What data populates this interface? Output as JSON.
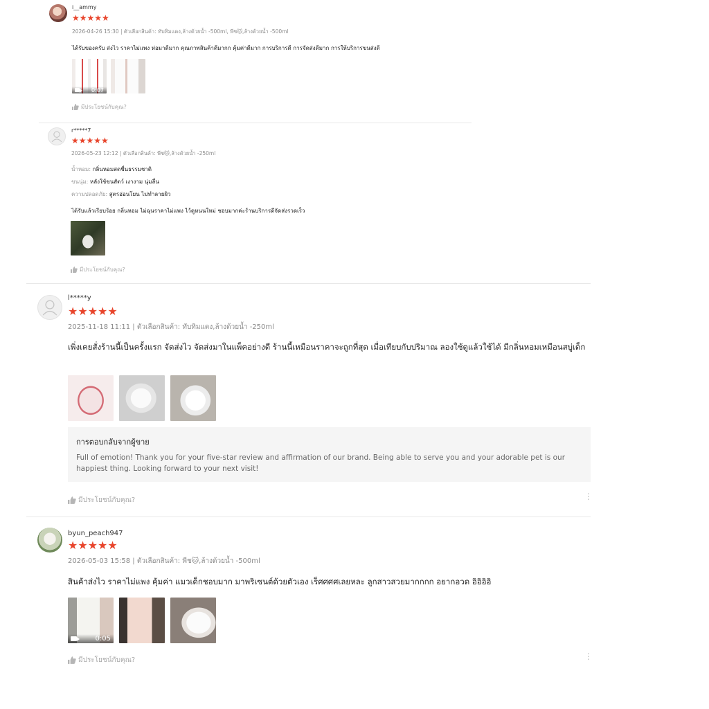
{
  "reviews": [
    {
      "username": "i__ammy",
      "stars": "★★★★★",
      "meta": "2026-04-26 15:30 | ตัวเลือกสินค้า: ทับทิมแดง,ล้างด้วยน้ำ -500ml, พีช🐱,ล้างด้วยน้ำ -500ml",
      "text": "ได้รับของครับ ส่งไว ราคาไม่แพง ห่อมาดีมาก คุณภาพสินค้าดีมากก คุ้มค่าดีมาก การบริการดี การจัดส่งดีมาก การให้บริการขนส่งดี",
      "video_duration": "0:07",
      "helpful": "มีประโยชน์กับคุณ?"
    },
    {
      "username": "r*****7",
      "stars": "★★★★★",
      "meta": "2026-05-23 12:12 | ตัวเลือกสินค้า: พีช🐱,ล้างด้วยน้ำ -250ml",
      "attributes": [
        {
          "key": "น้ำหอม:",
          "value": "กลิ่นหอมสดชื่นธรรมชาติ"
        },
        {
          "key": "ขนนุ่ม:",
          "value": "หลังใช้ขนสัตว์ เงางาม นุ่มลื่น"
        },
        {
          "key": "ความปลอดภัย:",
          "value": "สูตรอ่อนโยน ไม่ทำลายผิว"
        }
      ],
      "text": "ได้รับแล้วเรียบร้อย กลิ่นหอม ไม่ฉุนราคาไม่แพง ไว้ดูหนนใหม่ ชอบมากค่ะร้านบริการดีจัดส่งรวดเร็ว",
      "helpful": "มีประโยชน์กับคุณ?"
    },
    {
      "username": "l*****y",
      "stars": "★★★★★",
      "meta": "2025-11-18 11:11 | ตัวเลือกสินค้า: ทับทิมแดง,ล้างด้วยน้ำ -250ml",
      "text": "เพิ่งเคยสั่งร้านนี้เป็นครั้งแรก จัดส่งไว จัดส่งมาในแพ็คอย่างดี ร้านนี้เหมือนราคาจะถูกที่สุด เมื่อเทียบกับปริมาณ ลองใช้ดูแล้วใช้ได้ มีกลิ่นหอมเหมือนสบู่เด็ก",
      "reply_title": "การตอบกลับจากผู้ขาย",
      "reply_text": "Full of emotion! Thank you for your five-star review and affirmation of our brand. Being able to serve you and your adorable pet is our happiest thing. Looking forward to your next visit!",
      "helpful": "มีประโยชน์กับคุณ?"
    },
    {
      "username": "byun_peach947",
      "stars": "★★★★★",
      "meta": "2026-05-03 15:58 | ตัวเลือกสินค้า: พีช🐱,ล้างด้วยน้ำ -500ml",
      "text": "สินค้าส่งไว ราคาไม่แพง คุ้มค่า แมวเด็กชอบมาก มาพริเซนต์ด้วยตัวเอง เร็ศศศศเลยหละ ลูกสาวสวยมากกกก อยากอวด อิอิอิอิ",
      "video_duration": "0:05",
      "helpful": "มีประโยชน์กับคุณ?"
    }
  ],
  "icons": {
    "thumb_up": "thumb-up-icon",
    "video": "video-camera-icon",
    "more": "more-vertical-icon",
    "default_avatar": "user-avatar-icon"
  },
  "colors": {
    "star": "#e8452c",
    "meta": "#8a8a8a",
    "reply_bg": "#f5f5f5"
  }
}
